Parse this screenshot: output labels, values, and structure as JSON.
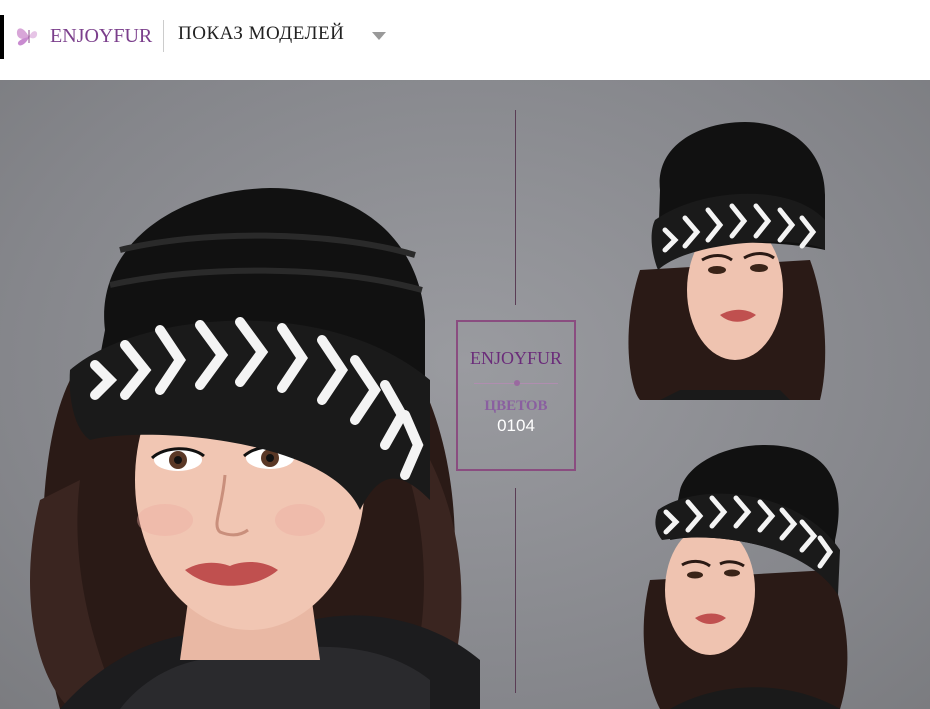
{
  "header": {
    "brand": "ENJOYFUR",
    "nav_title": "ПОКАЗ МОДЕЛЕЙ"
  },
  "badge": {
    "brand": "ENJOYFUR",
    "label": "ЦВЕТОВ",
    "code": "0104"
  },
  "colors": {
    "brand_purple": "#7b3f8c",
    "background_gray": "#8e8f94",
    "hat_black": "#111111",
    "fur_white": "#f2f2f2"
  },
  "icons": {
    "logo": "butterfly-icon",
    "dropdown": "caret-down-icon"
  }
}
